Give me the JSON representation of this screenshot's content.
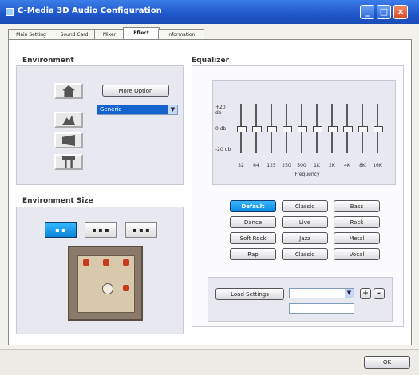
{
  "window": {
    "title": "C-Media 3D Audio Configuration",
    "controls": [
      "minimize-icon",
      "maximize-icon",
      "close-icon"
    ]
  },
  "tabs": [
    "Main Setting",
    "Sound Card",
    "Mixer",
    "Effect",
    "Information"
  ],
  "active_tab": "Effect",
  "environment": {
    "label": "Environment",
    "more_option": "More Option",
    "selected": "Generic",
    "preset_icons": [
      "house-icon",
      "mountain-icon",
      "stage-icon",
      "desk-icon"
    ]
  },
  "environment_size": {
    "label": "Environment Size",
    "size_icons": [
      "small-room-icon",
      "medium-room-icon",
      "large-room-icon"
    ],
    "selected_index": 0
  },
  "equalizer": {
    "label": "Equalizer",
    "y_labels": [
      "+20 db",
      "0 db",
      "-20 db"
    ],
    "freq_labels": [
      "32",
      "64",
      "125",
      "250",
      "500",
      "1K",
      "2K",
      "4K",
      "8K",
      "16K"
    ],
    "axis_label": "Frequency",
    "levels_db": [
      0,
      0,
      0,
      0,
      0,
      0,
      0,
      0,
      0,
      0
    ],
    "presets": [
      "Default",
      "Classic",
      "Bass",
      "Dance",
      "Live",
      "Rock",
      "Soft Rock",
      "Jazz",
      "Metal",
      "Rap",
      "Classic",
      "Vocal"
    ],
    "selected_preset": "Default"
  },
  "load_settings": {
    "label": "Load Settings",
    "dropdown_value": "",
    "text_value": "",
    "plus": "+",
    "minus": "-"
  },
  "ok_button": "OK"
}
